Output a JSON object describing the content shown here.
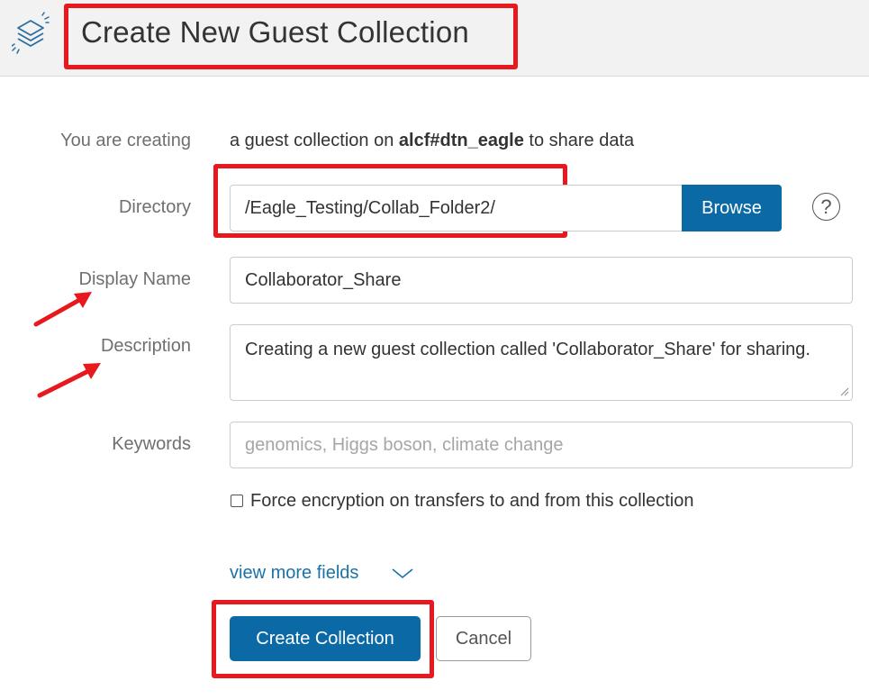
{
  "header": {
    "title": "Create New Guest Collection",
    "logo_icon": "layers-stack-icon"
  },
  "form": {
    "creating_label": "You are creating",
    "creating_prefix": "a guest collection on ",
    "endpoint_name": "alcf#dtn_eagle",
    "creating_suffix": " to share data",
    "directory_label": "Directory",
    "directory_value": "/Eagle_Testing/Collab_Folder2/",
    "browse_label": "Browse",
    "help_symbol": "?",
    "display_name_label": "Display Name",
    "display_name_value": "Collaborator_Share",
    "description_label": "Description",
    "description_value": "Creating a new guest collection called 'Collaborator_Share' for sharing.",
    "keywords_label": "Keywords",
    "keywords_placeholder": "genomics, Higgs boson, climate change",
    "encryption_label": "Force encryption on transfers to and from this collection",
    "encryption_checked": false,
    "view_more_label": "view more fields",
    "create_label": "Create Collection",
    "cancel_label": "Cancel"
  },
  "annotations": {
    "highlight_color": "#e8191e"
  },
  "colors": {
    "primary": "#0b6aa6",
    "link": "#1a73a8",
    "header_bg": "#f2f2f2"
  }
}
